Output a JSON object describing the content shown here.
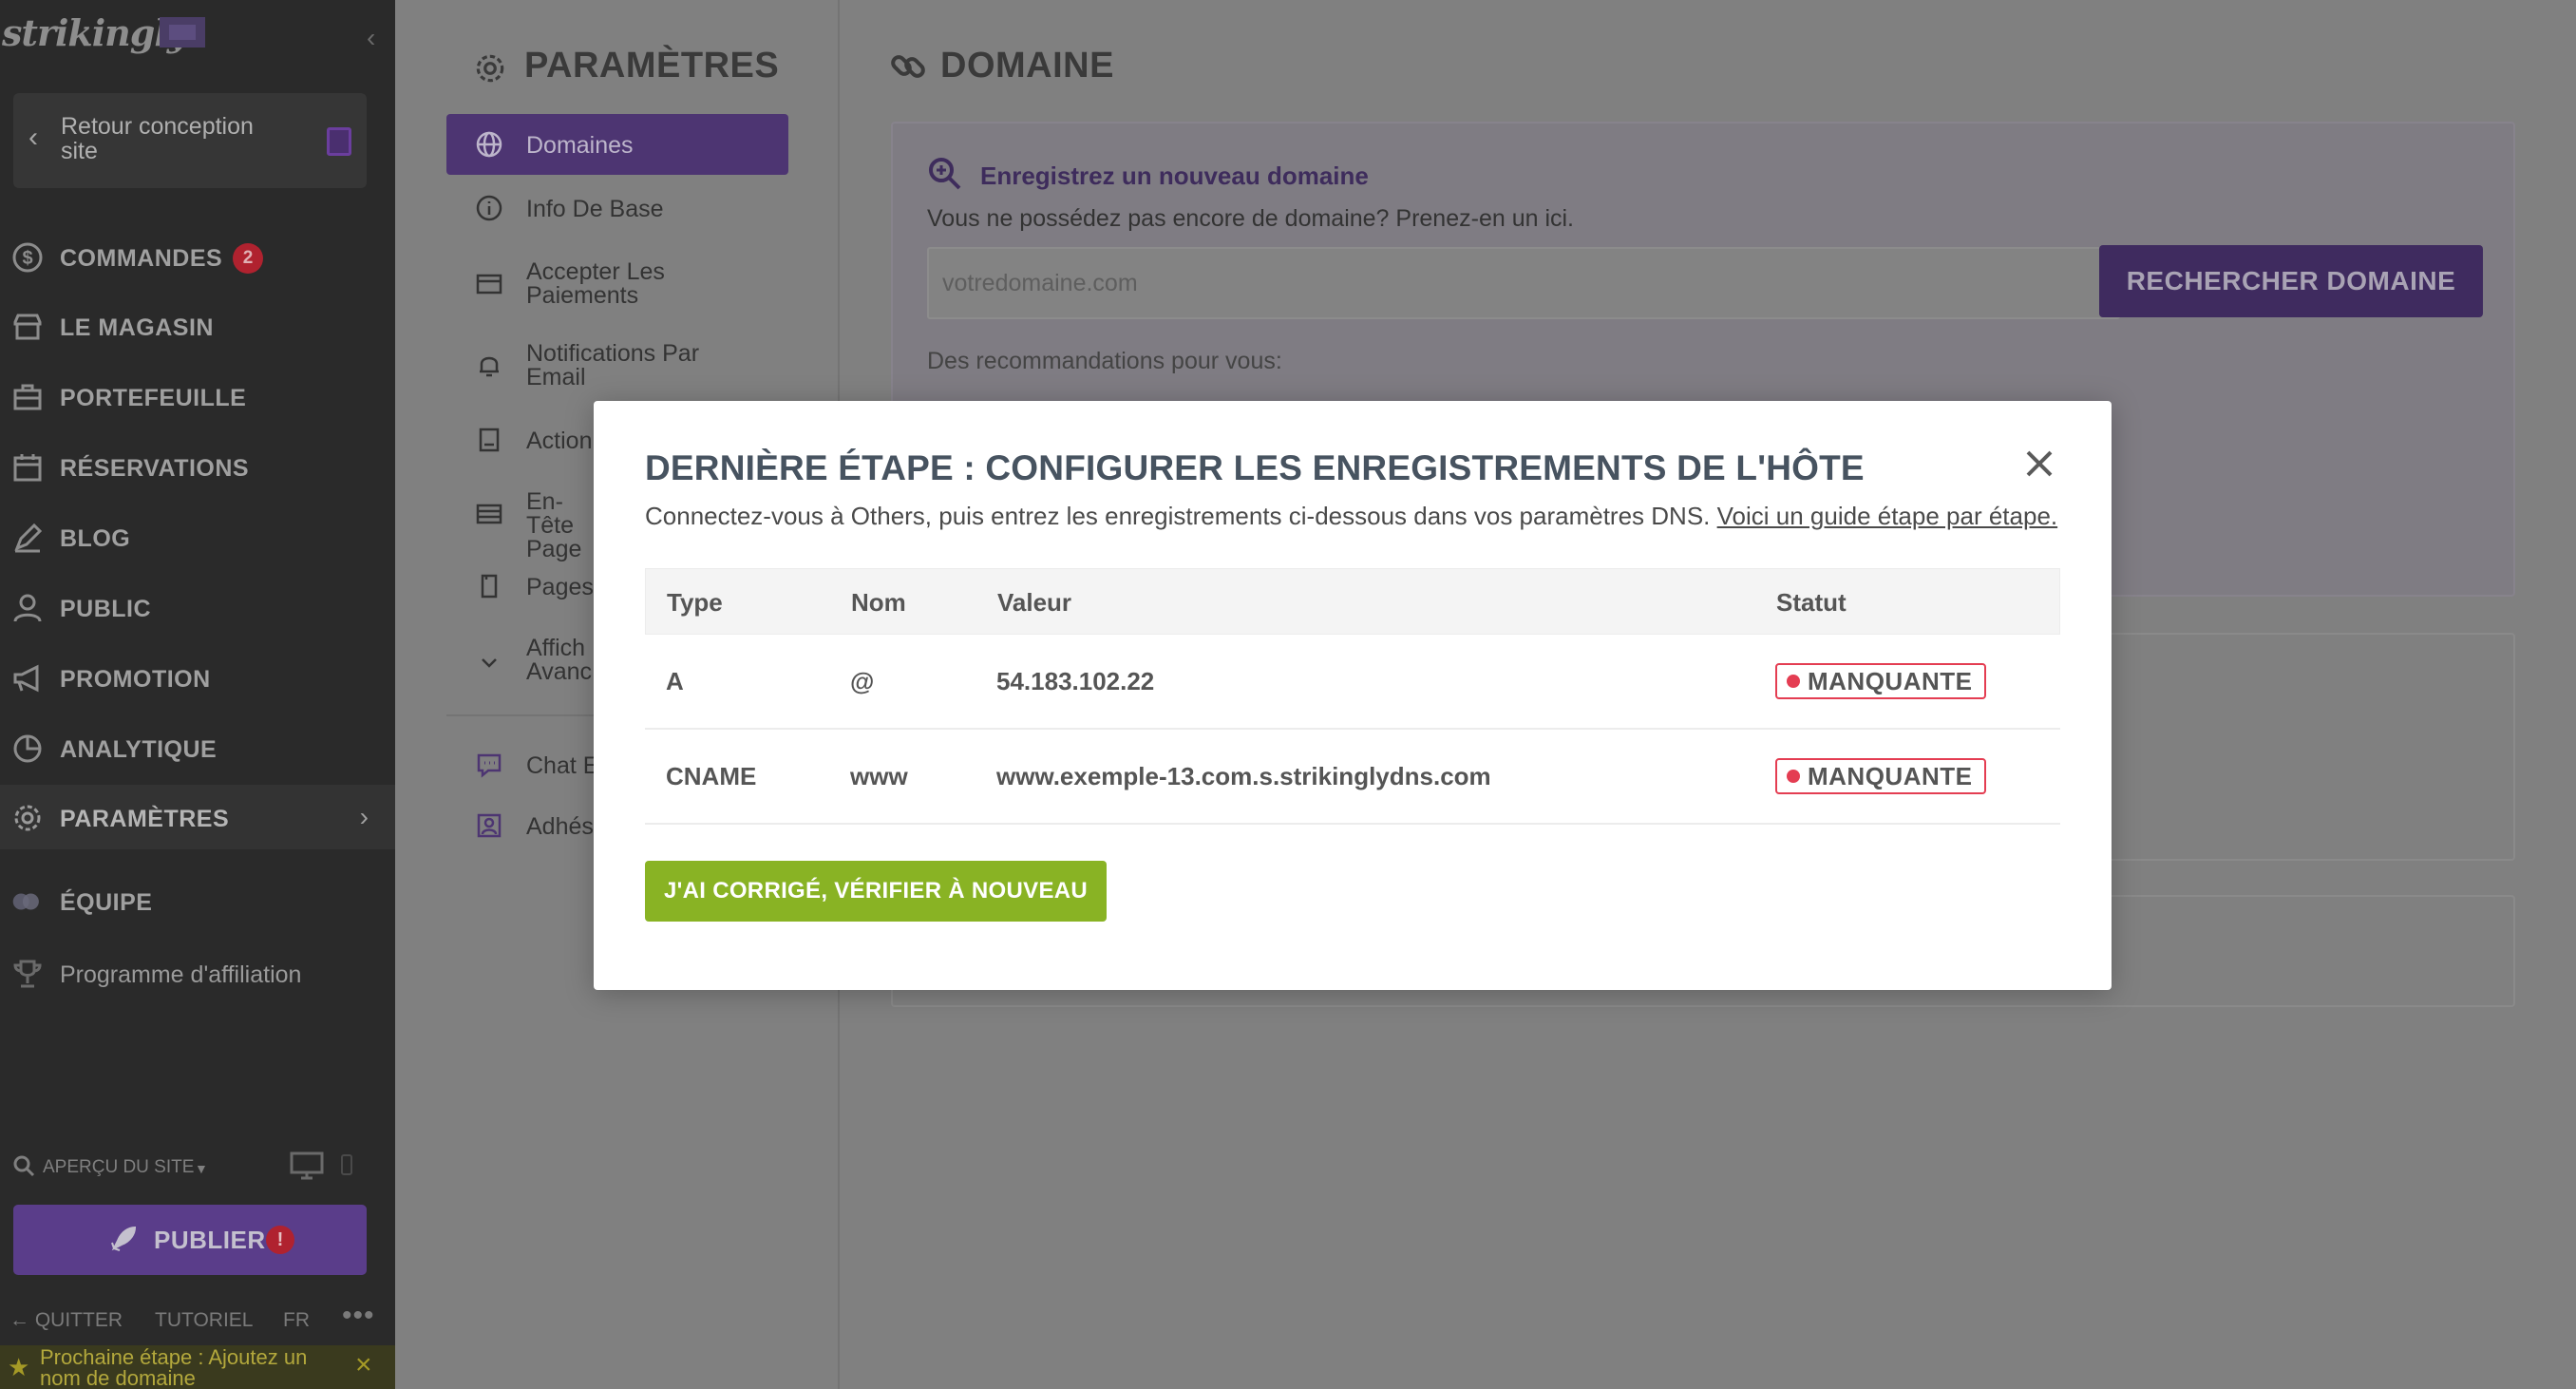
{
  "sidebar": {
    "logo": "strikingly",
    "back_label": "Retour conception site",
    "items": [
      {
        "label": "COMMANDES",
        "badge": "2",
        "icon": "dollar-icon"
      },
      {
        "label": "LE MAGASIN",
        "icon": "store-icon"
      },
      {
        "label": "PORTEFEUILLE",
        "icon": "briefcase-icon"
      },
      {
        "label": "RÉSERVATIONS",
        "icon": "calendar-icon"
      },
      {
        "label": "BLOG",
        "icon": "pen-icon"
      },
      {
        "label": "PUBLIC",
        "icon": "user-icon"
      },
      {
        "label": "PROMOTION",
        "icon": "megaphone-icon"
      },
      {
        "label": "ANALYTIQUE",
        "icon": "pie-chart-icon"
      },
      {
        "label": "PARAMÈTRES",
        "icon": "gear-icon",
        "active": true
      },
      {
        "label": "ÉQUIPE",
        "icon": "team-icon"
      },
      {
        "label": "Programme d'affiliation",
        "icon": "trophy-icon"
      }
    ],
    "preview_label": "APERÇU DU SITE",
    "publish_label": "PUBLIER",
    "publish_warning": "!",
    "footer": {
      "quit": "QUITTER",
      "tutorial": "TUTORIEL",
      "lang": "FR",
      "more": "•••"
    },
    "next_step": "Prochaine étape : Ajoutez un nom de domaine"
  },
  "settings": {
    "title": "PARAMÈTRES",
    "items": [
      {
        "label": "Domaines",
        "icon": "globe-icon",
        "active": true
      },
      {
        "label": "Info De Base",
        "icon": "info-icon"
      },
      {
        "label": "Accepter Les Paiements",
        "icon": "card-icon"
      },
      {
        "label": "Notifications Par Email",
        "icon": "bell-icon"
      },
      {
        "label": "Action",
        "icon": "book-icon"
      },
      {
        "label": "En-Tête Page",
        "icon": "header-icon"
      },
      {
        "label": "Pages",
        "icon": "page-icon"
      },
      {
        "label": "Affich Avanc",
        "icon": "chevron-down-icon"
      },
      {
        "label": "Chat E",
        "icon": "chat-icon"
      },
      {
        "label": "Adhés",
        "icon": "member-icon"
      }
    ]
  },
  "domain": {
    "title": "DOMAINE",
    "register_heading": "Enregistrez un nouveau domaine",
    "register_sub": "Vous ne possédez pas encore de domaine? Prenez-en un ici.",
    "input_placeholder": "votredomaine.com",
    "search_button": "RECHERCHER DOMAINE",
    "recommendations": "Des recommandations pour vous:"
  },
  "modal": {
    "title": "DERNIÈRE ÉTAPE : CONFIGURER LES ENREGISTREMENTS DE L'HÔTE",
    "desc": "Connectez-vous à Others, puis entrez les enregistrements ci-dessous dans vos paramètres DNS.",
    "guide_link": "Voici un guide étape par étape.",
    "columns": {
      "type": "Type",
      "nom": "Nom",
      "valeur": "Valeur",
      "statut": "Statut"
    },
    "rows": [
      {
        "type": "A",
        "nom": "@",
        "valeur": "54.183.102.22",
        "statut": "MANQUANTE"
      },
      {
        "type": "CNAME",
        "nom": "www",
        "valeur": "www.exemple-13.com.s.strikinglydns.com",
        "statut": "MANQUANTE"
      }
    ],
    "verify_button": "J'AI CORRIGÉ, VÉRIFIER À NOUVEAU"
  },
  "colors": {
    "sidebar_bg": "#2a2a2a",
    "accent_purple": "#6b4aa6",
    "status_red": "#e43d52",
    "verify_green": "#89b324"
  }
}
